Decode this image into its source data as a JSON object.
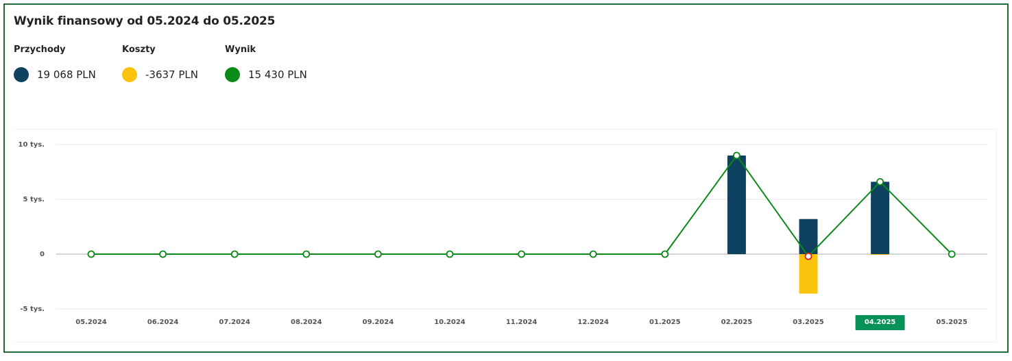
{
  "title": "Wynik finansowy od 05.2024 do 05.2025",
  "legend": [
    {
      "label": "Przychody",
      "value": "19 068 PLN",
      "color": "#0f4260"
    },
    {
      "label": "Koszty",
      "value": "-3637 PLN",
      "color": "#fbc30d"
    },
    {
      "label": "Wynik",
      "value": "15 430 PLN",
      "color": "#0a8a17"
    }
  ],
  "chart_data": {
    "type": "bar",
    "categories": [
      "05.2024",
      "06.2024",
      "07.2024",
      "08.2024",
      "09.2024",
      "10.2024",
      "11.2024",
      "12.2024",
      "01.2025",
      "02.2025",
      "03.2025",
      "04.2025",
      "05.2025"
    ],
    "highlighted_category": "04.2025",
    "y_tick_labels": [
      "10 tys.",
      "5 tys.",
      "0",
      "-5 tys."
    ],
    "y_tick_values": [
      10000,
      5000,
      0,
      -5000
    ],
    "ylim": [
      -5000,
      10000
    ],
    "grid": true,
    "series": [
      {
        "name": "Przychody",
        "type": "bar",
        "color": "#0f4260",
        "values": [
          0,
          0,
          0,
          0,
          0,
          0,
          0,
          0,
          0,
          9000,
          3200,
          6600,
          0
        ]
      },
      {
        "name": "Koszty",
        "type": "bar",
        "color": "#fbc30d",
        "values": [
          0,
          0,
          0,
          0,
          0,
          0,
          0,
          0,
          0,
          0,
          -3600,
          -30,
          0
        ]
      },
      {
        "name": "Wynik",
        "type": "line",
        "color": "#0a8a17",
        "values": [
          0,
          0,
          0,
          0,
          0,
          0,
          0,
          0,
          0,
          9000,
          -200,
          6600,
          0
        ]
      }
    ]
  }
}
